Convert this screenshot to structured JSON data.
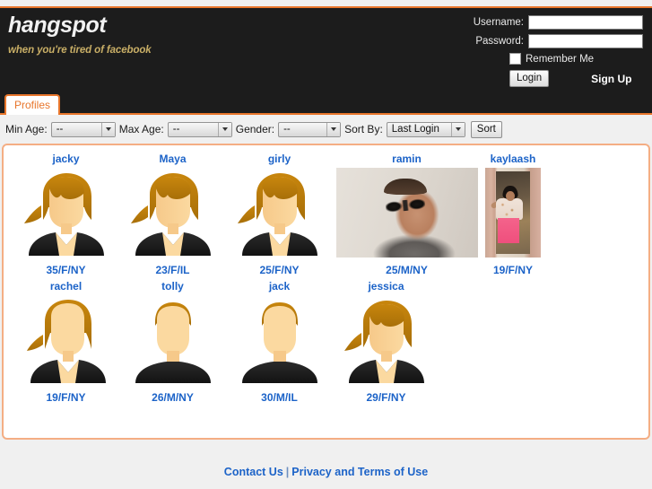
{
  "theme": {
    "accent_orange": "#e8762c",
    "panel_border": "#f4ae84",
    "link_blue": "#1c63c8",
    "header_bg": "#1c1c1c",
    "page_bg": "#f0f0f0",
    "tagline_gold": "#c8ae66"
  },
  "header": {
    "brand_title": "hangspot",
    "tagline": "when you're tired of facebook"
  },
  "login": {
    "username_label": "Username:",
    "username_value": "",
    "username_placeholder": "",
    "password_label": "Password:",
    "password_value": "",
    "password_placeholder": "",
    "remember_label": "Remember Me",
    "remember_checked": false,
    "login_button": "Login",
    "signup_link": "Sign Up"
  },
  "tabs": [
    {
      "label": "Profiles",
      "active": true
    }
  ],
  "filters": {
    "min_age": {
      "label": "Min Age:",
      "value": "--",
      "options": [
        "--"
      ]
    },
    "max_age": {
      "label": "Max Age:",
      "value": "--",
      "options": [
        "--"
      ]
    },
    "gender": {
      "label": "Gender:",
      "value": "--",
      "options": [
        "--"
      ]
    },
    "sort_by": {
      "label": "Sort By:",
      "value": "Last Login",
      "options": [
        "Last Login"
      ]
    },
    "sort_button": "Sort"
  },
  "profiles": [
    {
      "name": "jacky",
      "meta": "35/F/NY",
      "avatar": "female-long",
      "kind": "avatar"
    },
    {
      "name": "Maya",
      "meta": "23/F/IL",
      "avatar": "female-long",
      "kind": "avatar"
    },
    {
      "name": "girly",
      "meta": "25/F/NY",
      "avatar": "female-long",
      "kind": "avatar"
    },
    {
      "name": "ramin",
      "meta": "25/M/NY",
      "avatar": "photo-ramin",
      "kind": "photo-wide"
    },
    {
      "name": "kaylaash",
      "meta": "19/F/NY",
      "avatar": "photo-kayla",
      "kind": "photo-narrow"
    },
    {
      "name": "rachel",
      "meta": "19/F/NY",
      "avatar": "female-bob",
      "kind": "avatar"
    },
    {
      "name": "tolly",
      "meta": "26/M/NY",
      "avatar": "male-short",
      "kind": "avatar"
    },
    {
      "name": "jack",
      "meta": "30/M/IL",
      "avatar": "male-short",
      "kind": "avatar"
    },
    {
      "name": "jessica",
      "meta": "29/F/NY",
      "avatar": "female-long",
      "kind": "avatar"
    }
  ],
  "footer": {
    "contact_link": "Contact Us",
    "separator": "|",
    "terms_link": "Privacy and Terms of Use"
  }
}
